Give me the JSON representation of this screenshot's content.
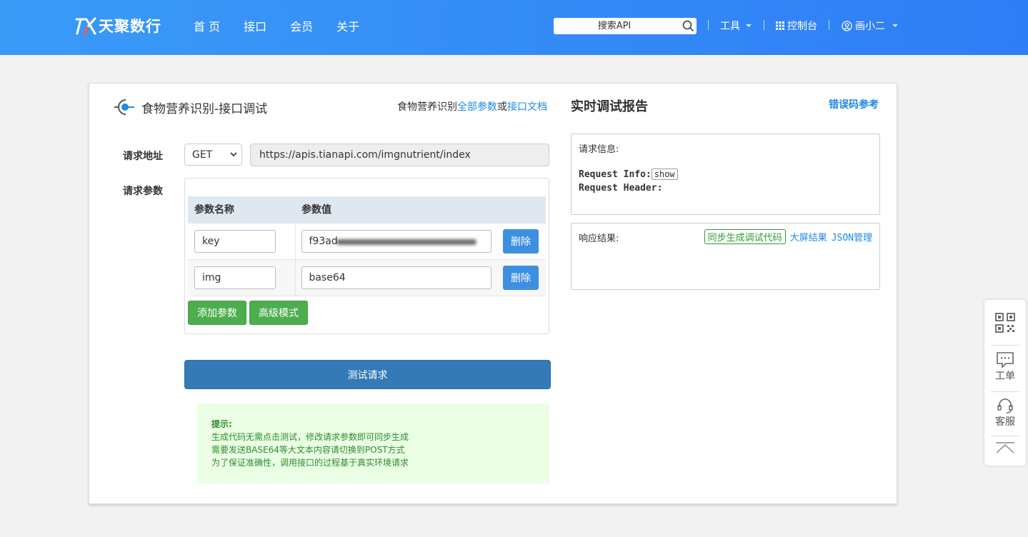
{
  "header": {
    "brand": "天聚数行",
    "nav": [
      "首 页",
      "接口",
      "会员",
      "关于"
    ],
    "search_placeholder": "搜索API",
    "tools": "工具",
    "console": "控制台",
    "user": "画小二"
  },
  "main": {
    "title": "食物营养识别-接口调试",
    "doc_prefix": "食物营养识别",
    "all_params": "全部参数",
    "or": "或",
    "api_doc": "接口文档",
    "url_label": "请求地址",
    "method": "GET",
    "url": "https://apis.tianapi.com/imgnutrient/index",
    "params_label": "请求参数",
    "col_name": "参数名称",
    "col_value": "参数值",
    "params": [
      {
        "name": "key",
        "value": "f93ad"
      },
      {
        "name": "img",
        "value": "base64"
      }
    ],
    "delete": "删除",
    "add_param": "添加参数",
    "advanced": "高级模式",
    "test": "测试请求",
    "tip_title": "提示:",
    "tips": [
      "生成代码无需点击测试，修改请求参数即可同步生成",
      "需要发送BASE64等大文本内容请切换到POST方式",
      "为了保证准确性，调用接口的过程基于真实环境请求"
    ]
  },
  "report": {
    "title": "实时调试报告",
    "error_ref": "错误码参考",
    "req_info": "请求信息:",
    "request_info": "Request Info:",
    "show": "show",
    "request_header": "Request Header:",
    "response": "响应结果:",
    "gen_code": "同步生成调试代码",
    "big_screen": "大屏结果",
    "json_mgmt_a": "JSON",
    "json_mgmt_b": "管理"
  },
  "side": {
    "ticket": "工单",
    "service": "客服"
  },
  "colors": {
    "header_start": "#3a9bf7",
    "header_end": "#2f7df5",
    "primary": "#337ab7",
    "link": "#1e88e5",
    "success": "#4cae4c"
  }
}
